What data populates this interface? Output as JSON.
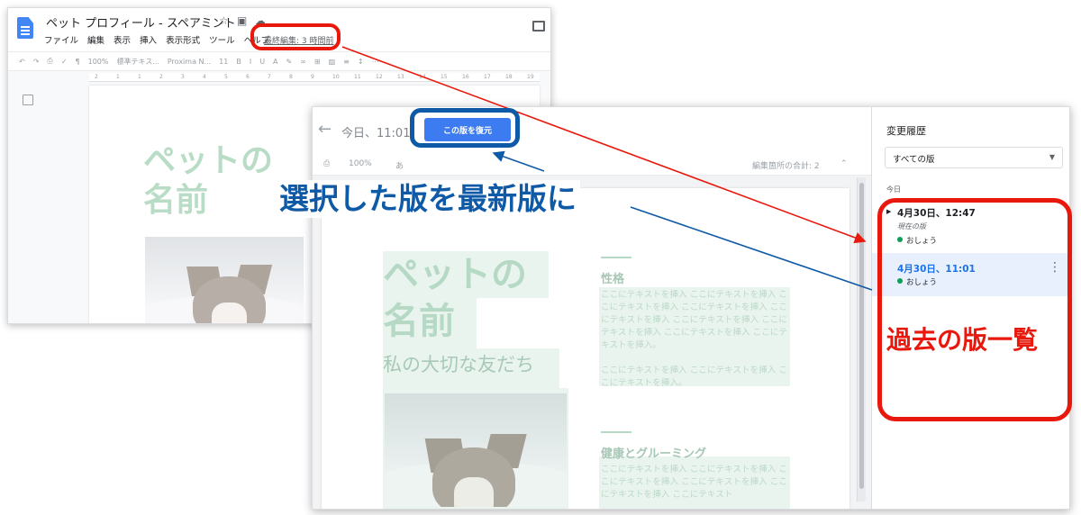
{
  "editor": {
    "title": "ペット プロフィール - スペアミント",
    "menu": [
      "ファイル",
      "編集",
      "表示",
      "挿入",
      "表示形式",
      "ツール",
      "ヘルプ"
    ],
    "last_edit": "最終編集: 3 時間前",
    "toolbar": {
      "zoom": "100%",
      "style": "標準テキス...",
      "font": "Proxima N...",
      "font_size": "11"
    },
    "ruler": [
      "2",
      "1",
      "1",
      "2",
      "3",
      "4",
      "5",
      "6",
      "7",
      "8",
      "9",
      "10",
      "11",
      "12",
      "13",
      "14",
      "15",
      "16",
      "17",
      "18",
      "19"
    ],
    "page_title": "ペットの\n名前"
  },
  "history": {
    "current_label": "今日、11:01",
    "restore_button": "この版を復元",
    "zoom": "100%",
    "edit_count": "編集箇所の合計: 2",
    "page": {
      "title": "ペットの\n名前",
      "subtitle": "私の大切な友だち",
      "sections": [
        {
          "heading": "性格",
          "text": "ここにテキストを挿入 ここにテキストを挿入 ここにテキストを挿入 ここにテキストを挿入 ここにテキストを挿入 ここにテキストを挿入 ここにテキストを挿入 ここにテキストを挿入 ここにテキストを挿入。\n\nここにテキストを挿入 ここにテキストを挿入 ここにテキストを挿入。"
        },
        {
          "heading": "健康とグルーミング",
          "text": "ここにテキストを挿入 ここにテキストを挿入 ここにテキストを挿入 ここにテキストを挿入 ここにテキストを挿入 ここにテキスト"
        }
      ]
    },
    "sidebar": {
      "title": "変更履歴",
      "filter": "すべての版",
      "group": "今日",
      "versions": [
        {
          "time": "4月30日、12:47",
          "note": "現在の版",
          "user": "おしょう"
        },
        {
          "time": "4月30日、11:01",
          "user": "おしょう"
        }
      ]
    }
  },
  "annotations": {
    "restore_caption": "選択した版を最新版に",
    "versions_caption": "過去の版一覧"
  },
  "colors": {
    "callout_red": "#e8190c",
    "callout_blue": "#0f5aa6",
    "accent_blue": "#3d7cf0",
    "user_dot": "#0f9d58"
  }
}
